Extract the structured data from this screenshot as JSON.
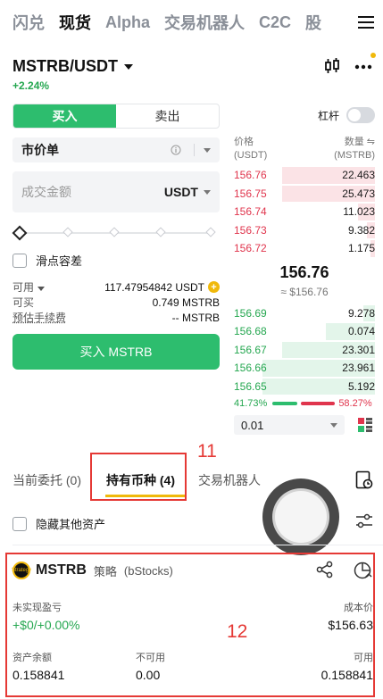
{
  "nav": {
    "items": [
      "闪兑",
      "现货",
      "Alpha",
      "交易机器人",
      "C2C",
      "股"
    ],
    "active_index": 1
  },
  "pair": {
    "symbol": "MSTRB/USDT",
    "change": "+2.24%"
  },
  "order_form": {
    "buy_label": "买入",
    "sell_label": "卖出",
    "order_type": "市价单",
    "amount_placeholder": "成交金额",
    "amount_unit": "USDT",
    "slippage_label": "滑点容差",
    "available_label": "可用",
    "available_value": "117.47954842 USDT",
    "buyable_label": "可买",
    "buyable_value": "0.749 MSTRB",
    "fee_label": "预估手续费",
    "fee_value": "-- MSTRB",
    "submit_label": "买入 MSTRB"
  },
  "order_book": {
    "leverage_label": "杠杆",
    "price_header": "价格",
    "price_unit": "(USDT)",
    "qty_header": "数量",
    "qty_unit": "(MSTRB)",
    "asks": [
      {
        "price": "156.76",
        "qty": "22.463",
        "depth": 0.66
      },
      {
        "price": "156.75",
        "qty": "25.473",
        "depth": 0.66
      },
      {
        "price": "156.74",
        "qty": "11.023",
        "depth": 0.12
      },
      {
        "price": "156.73",
        "qty": "9.382",
        "depth": 0.06
      },
      {
        "price": "156.72",
        "qty": "1.175",
        "depth": 0.03
      }
    ],
    "last_price": "156.76",
    "last_fiat": "≈ $156.76",
    "bids": [
      {
        "price": "156.69",
        "qty": "9.278",
        "depth": 0.08
      },
      {
        "price": "156.68",
        "qty": "0.074",
        "depth": 0.35
      },
      {
        "price": "156.67",
        "qty": "23.301",
        "depth": 0.66
      },
      {
        "price": "156.66",
        "qty": "23.961",
        "depth": 0.8
      },
      {
        "price": "156.65",
        "qty": "5.192",
        "depth": 0.8
      }
    ],
    "buy_ratio": "41.73%",
    "sell_ratio": "58.27%",
    "buy_ratio_value": 41.73,
    "depth_value": "0.01"
  },
  "tabs": {
    "open_orders": "当前委托 (0)",
    "holdings": "持有币种 (4)",
    "bots": "交易机器人"
  },
  "hide_other_assets": "隐藏其他资产",
  "annotations": {
    "label_11": "11",
    "label_12": "12"
  },
  "asset": {
    "symbol": "MSTRB",
    "tag": "策略",
    "source": "(bStocks)",
    "logo_text": "Strategy",
    "unrealized_label": "未实现盈亏",
    "unrealized_value": "+$0/+0.00%",
    "cost_label": "成本价",
    "cost_value": "$156.63",
    "balance_label": "资产余额",
    "balance_value": "0.158841",
    "unavailable_label": "不可用",
    "unavailable_value": "0.00",
    "available_label": "可用",
    "available_value": "0.158841"
  },
  "colors": {
    "green": "#2dbd6e",
    "red": "#e0354d",
    "brand": "#f0b90b",
    "annotation": "#e53935"
  }
}
